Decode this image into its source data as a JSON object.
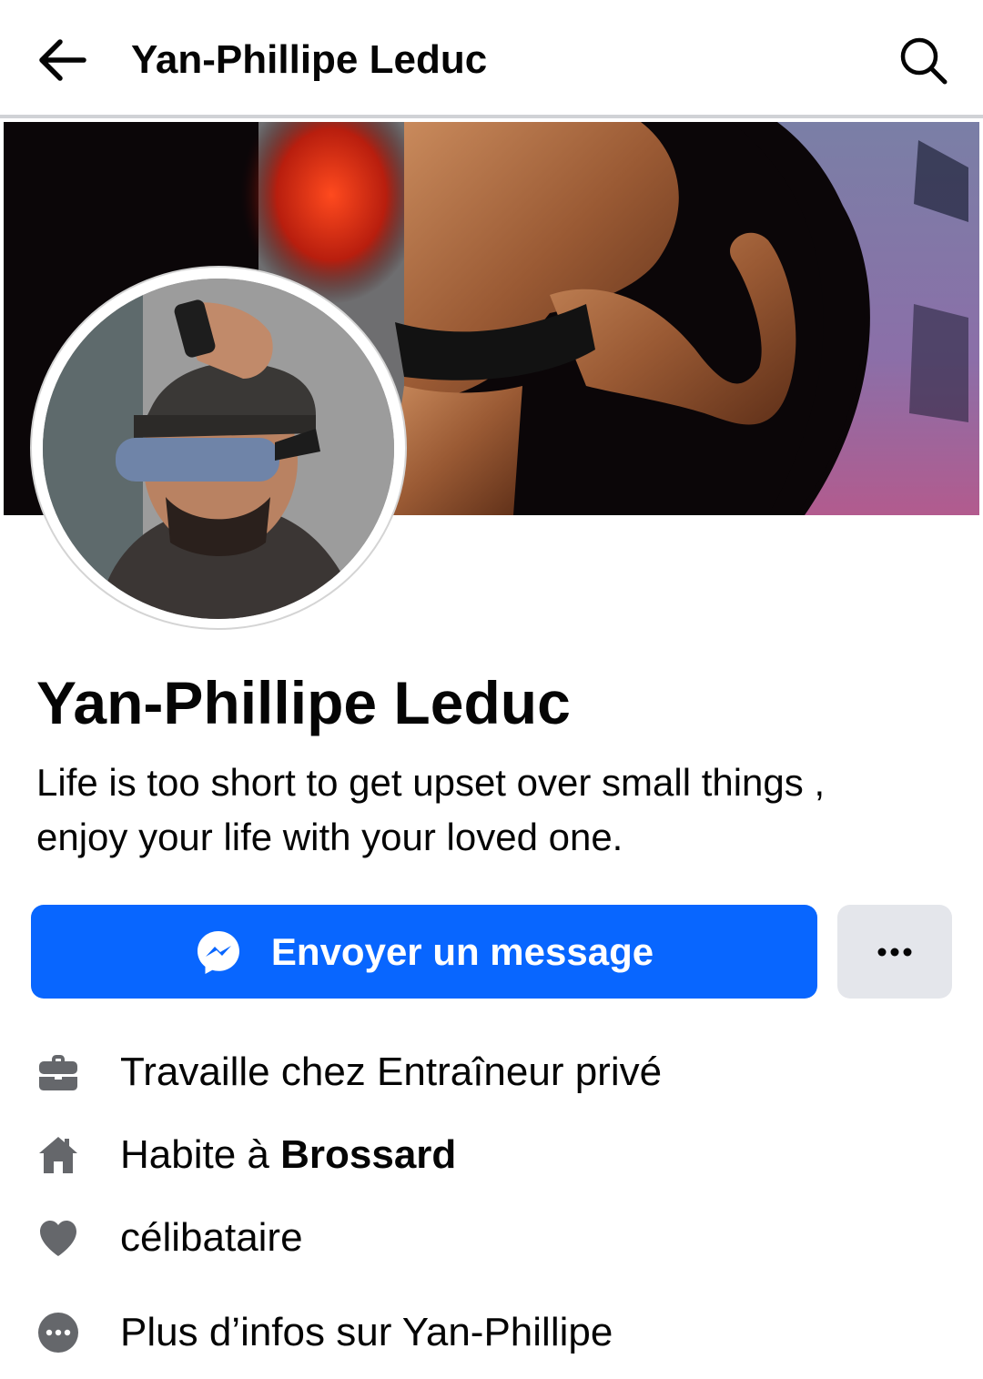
{
  "header": {
    "title": "Yan-Phillipe Leduc",
    "back_icon": "arrow-left-icon",
    "search_icon": "search-icon"
  },
  "profile": {
    "name": "Yan-Phillipe Leduc",
    "bio_line1": "Life is too short to get upset over small things ,",
    "bio_line2": "enjoy your life with your loved one."
  },
  "actions": {
    "message_label": "Envoyer un message",
    "message_icon": "messenger-icon",
    "more_icon": "more-dots-icon"
  },
  "details": {
    "work_text": "Travaille chez Entraîneur privé",
    "home_prefix": "Habite à ",
    "home_city": "Brossard",
    "relationship": "célibataire",
    "more_info": "Plus d’infos sur Yan-Phillipe"
  },
  "colors": {
    "accent": "#0866ff",
    "secondary_button": "#e4e6eb",
    "icon_gray": "#65676b"
  }
}
